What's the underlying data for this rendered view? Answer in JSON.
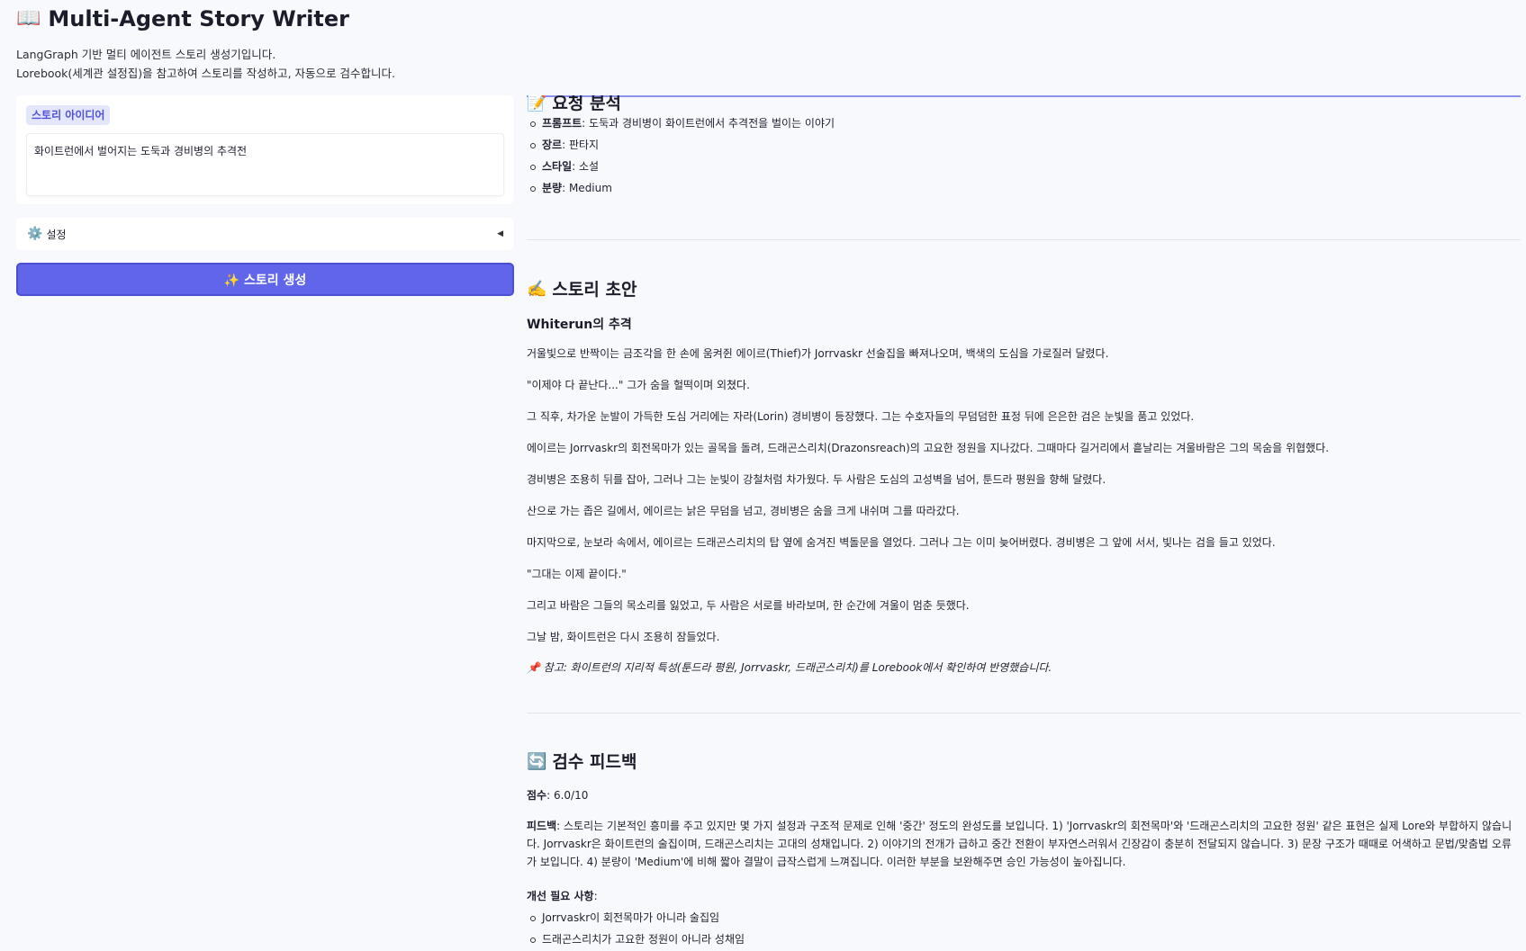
{
  "header": {
    "icon": "open-book-icon",
    "title": "Multi-Agent Story Writer",
    "subtitle_line1": "LangGraph 기반 멀티 에이전트 스토리 생성기입니다.",
    "subtitle_line2": "Lorebook(세계관 설정집)을 참고하여 스토리를 작성하고, 자동으로 검수합니다."
  },
  "input": {
    "label": "스토리 아이디어",
    "value": "화이트런에서 벌어지는 도둑과 경비병의 추격전"
  },
  "settings": {
    "label": "설정",
    "icon": "gear-icon"
  },
  "generate_button": {
    "label": "✨ 스토리 생성"
  },
  "analysis": {
    "heading": "요청 분석",
    "icon": "memo-icon",
    "items": [
      {
        "key": "프롬프트",
        "value": ": 도둑과 경비병이 화이트런에서 추격전을 벌이는 이야기"
      },
      {
        "key": "장르",
        "value": ": 판타지"
      },
      {
        "key": "스타일",
        "value": ": 소설"
      },
      {
        "key": "분량",
        "value": ": Medium"
      }
    ]
  },
  "draft": {
    "heading": "스토리 초안",
    "icon": "writing-hand-icon",
    "story_title": "Whiterun의 추격",
    "paragraphs": [
      "거울빛으로 반짝이는 금조각을 한 손에 움켜쥔 에이르(Thief)가 Jorrvaskr 선술집을 빠져나오며, 백색의 도심을 가로질러 달렸다.",
      "\"이제야 다 끝난다...\" 그가 숨을 헐떡이며 외쳤다.",
      "그 직후, 차가운 눈발이 가득한 도심 거리에는 자라(Lorin) 경비병이 등장했다. 그는 수호자들의 무덤덤한 표정 뒤에 은은한 검은 눈빛을 품고 있었다.",
      "에이르는 Jorrvaskr의 회전목마가 있는 골목을 돌려, 드래곤스리치(Drazonsreach)의 고요한 정원을 지나갔다. 그때마다 길거리에서 흩날리는 겨울바람은 그의 목숨을 위협했다.",
      "경비병은 조용히 뒤를 잡아, 그러나 그는 눈빛이 강철처럼 차가웠다. 두 사람은 도심의 고성벽을 넘어, 툰드라 평원을 향해 달렸다.",
      "산으로 가는 좁은 길에서, 에이르는 낡은 무덤을 넘고, 경비병은 숨을 크게 내쉬며 그를 따라갔다.",
      "마지막으로, 눈보라 속에서, 에이르는 드래곤스리치의 탑 옆에 숨겨진 벽돌문을 열었다. 그러나 그는 이미 늦어버렸다. 경비병은 그 앞에 서서, 빛나는 검을 들고 있었다.",
      "\"그대는 이제 끝이다.\"",
      "그리고 바람은 그들의 목소리를 잃었고, 두 사람은 서로를 바라보며, 한 순간에 겨울이 멈춘 듯했다.",
      "그날 밤, 화이트런은 다시 조용히 잠들었다."
    ],
    "note_icon": "pushpin-icon",
    "note": "참고: 화이트런의 지리적 특성(툰드라 평원, Jorrvaskr, 드래곤스리치)를 Lorebook에서 확인하여 반영했습니다."
  },
  "review": {
    "heading": "검수 피드백",
    "icon": "refresh-icon",
    "score_label": "점수",
    "score_value": ": 6.0/10",
    "feedback_label": "피드백",
    "feedback_text": ": 스토리는 기본적인 흥미를 주고 있지만 몇 가지 설정과 구조적 문제로 인해 '중간' 정도의 완성도를 보입니다. 1) 'Jorrvaskr의 회전목마'와 '드래곤스리치의 고요한 정원' 같은 표현은 실제 Lore와 부합하지 않습니다. Jorrvaskr은 화이트런의 술집이며, 드래곤스리치는 고대의 성채입니다. 2) 이야기의 전개가 급하고 중간 전환이 부자연스러워서 긴장감이 충분히 전달되지 않습니다. 3) 문장 구조가 때때로 어색하고 문법/맞춤법 오류가 보입니다. 4) 분량이 'Medium'에 비해 짧아 결말이 급작스럽게 느껴집니다. 이러한 부분을 보완해주면 승인 가능성이 높아집니다.",
    "improve_label": "개선 필요 사항",
    "improve_suffix": ":",
    "improve_items": [
      "Jorrvaskr이 회전목마가 아니라 술집임",
      "드래곤스리치가 고요한 정원이 아니라 성채임"
    ]
  }
}
